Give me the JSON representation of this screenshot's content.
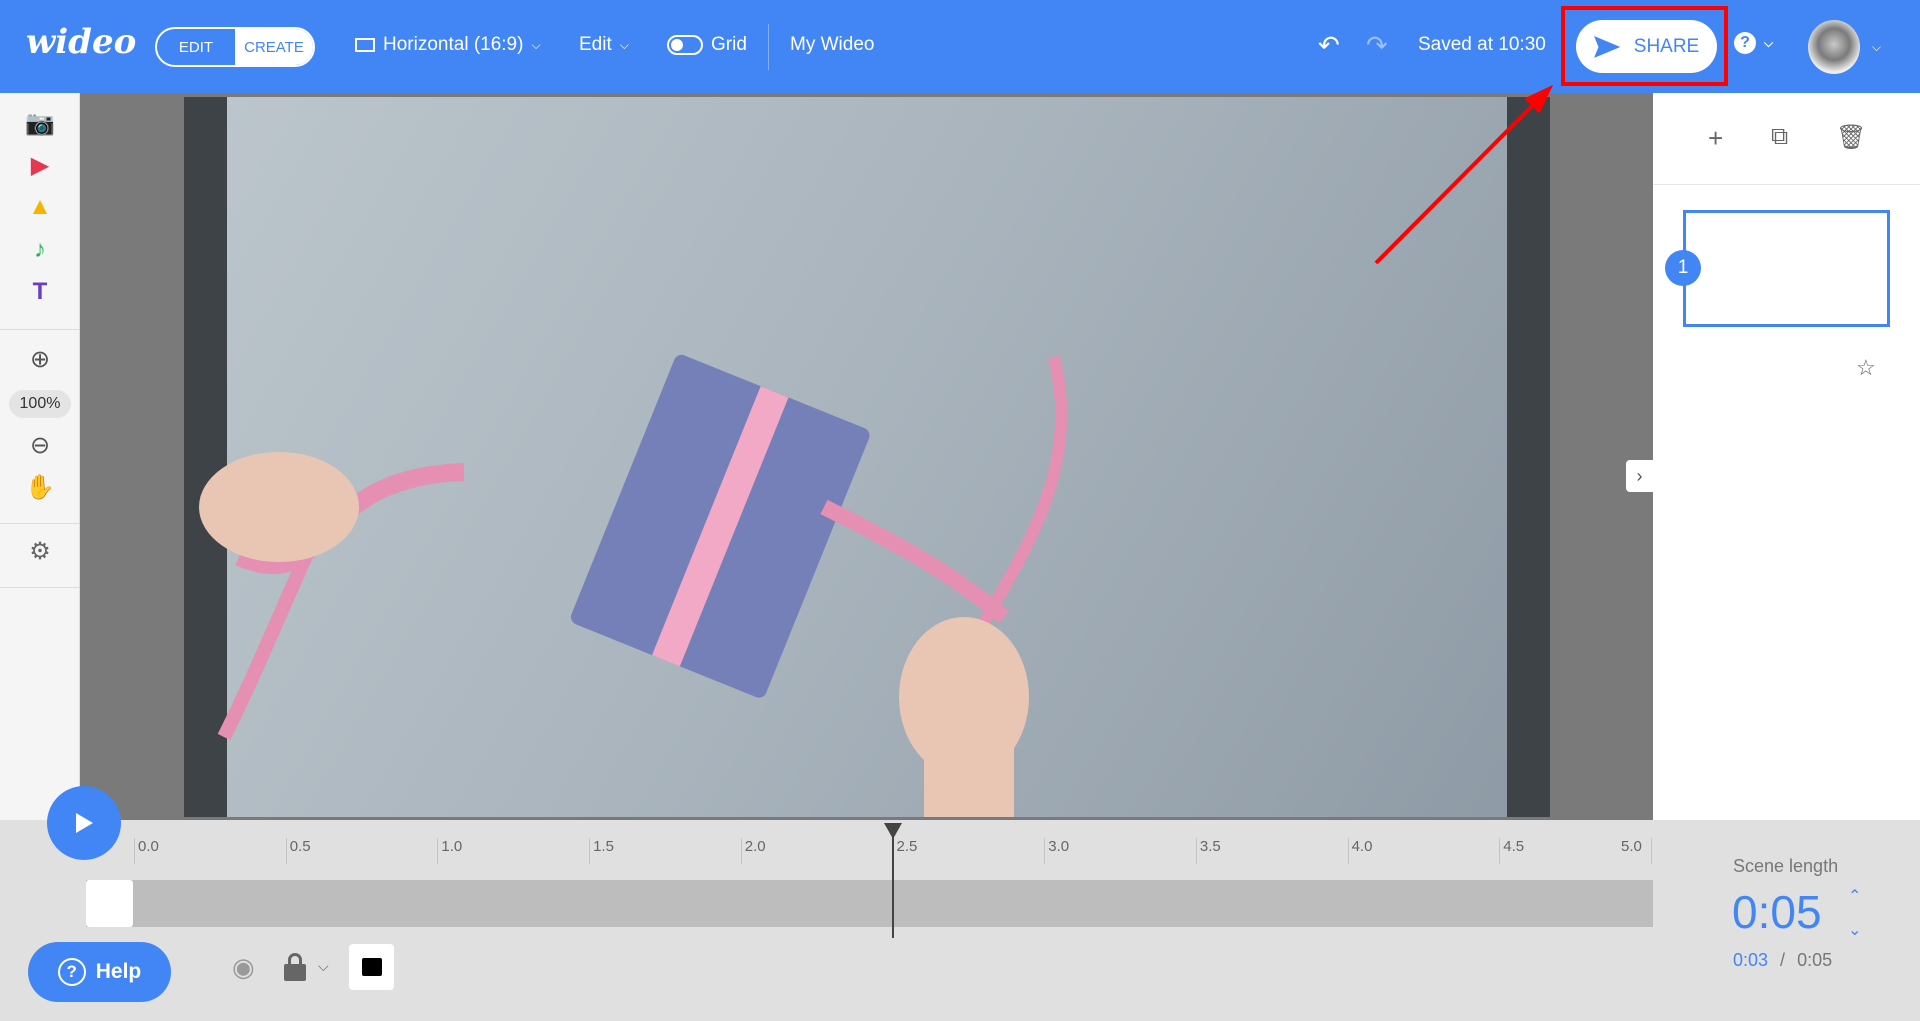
{
  "header": {
    "logo": "wideo",
    "mode_edit": "EDIT",
    "mode_create": "CREATE",
    "format": "Horizontal (16:9)",
    "edit_menu": "Edit",
    "grid_label": "Grid",
    "project_name": "My Wideo",
    "saved_status": "Saved at 10:30",
    "share_label": "SHARE"
  },
  "toolbar": {
    "zoom_level": "100%"
  },
  "scenes": [
    {
      "number": "1"
    }
  ],
  "timeline": {
    "ticks": [
      "0.0",
      "0.5",
      "1.0",
      "1.5",
      "2.0",
      "2.5",
      "3.0",
      "3.5",
      "4.0",
      "4.5",
      "5.0"
    ],
    "playhead_seconds": 2.5
  },
  "scene_length": {
    "label": "Scene length",
    "value": "0:05",
    "current": "0:03",
    "separator": "/",
    "total": "0:05"
  },
  "help_label": "Help",
  "colors": {
    "brand": "#4285f4",
    "annotation": "#ff0000"
  }
}
